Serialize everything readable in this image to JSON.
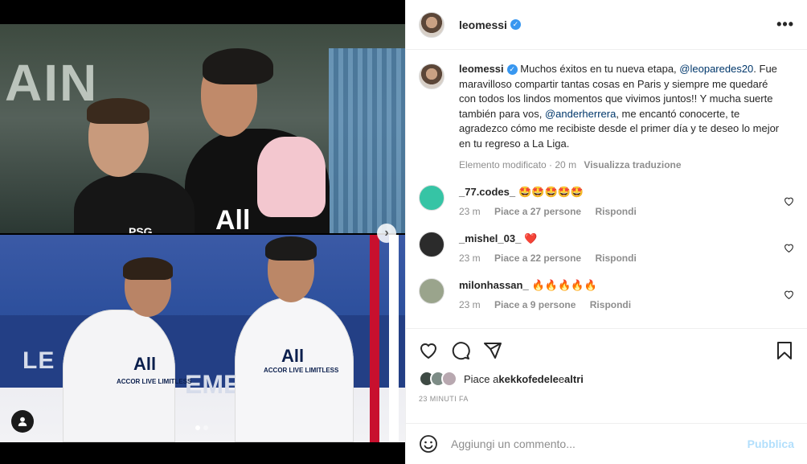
{
  "post": {
    "author": "leomessi",
    "verified": true,
    "more_icon": "more-options-icon"
  },
  "media": {
    "top_wall_text": "AIN",
    "top_jersey_logo": "All",
    "top_jersey_logo_small": "PSG",
    "bottom_wall_text": "LE",
    "bottom_wall_text2": "EMENT",
    "bottom_jersey_logo": "All",
    "bottom_jersey_sub": "ACCOR LIVE LIMITLESS",
    "carousel_dots": 2,
    "active_dot": 0
  },
  "caption": {
    "username": "leomessi",
    "parts": {
      "p1": " Muchos éxitos en tu nueva etapa, ",
      "m1": "@leoparedes20",
      "p2": ". Fue maravilloso compartir tantas cosas en Paris y siempre me quedaré con todos los lindos momentos que vivimos juntos!! Y mucha suerte también para vos, ",
      "m2": "@anderherrera",
      "p3": ", me encantó conocerte, te agradezco cómo me recibiste desde el primer día y te deseo lo mejor en tu regreso a La Liga."
    },
    "edited": "Elemento modificato · 20 m",
    "translate": "Visualizza traduzione"
  },
  "comments": [
    {
      "username": "_77.codes_",
      "text": "🤩🤩🤩🤩🤩",
      "time": "23 m",
      "likes": "Piace a 27 persone",
      "reply": "Rispondi",
      "avatar_color": "#36c4a5"
    },
    {
      "username": "_mishel_03_",
      "text": "❤️",
      "time": "23 m",
      "likes": "Piace a 22 persone",
      "reply": "Rispondi",
      "avatar_color": "#2b2b2b"
    },
    {
      "username": "milonhassan_",
      "text": "🔥🔥🔥🔥🔥",
      "time": "23 m",
      "likes": "Piace a 9 persone",
      "reply": "Rispondi",
      "avatar_color": "#9aa48c"
    }
  ],
  "likes": {
    "prefix": "Piace a ",
    "user": "kekkofedele",
    "mid": " e ",
    "others": "altri"
  },
  "timestamp": "23 MINUTI FA",
  "add_comment": {
    "placeholder": "Aggiungi un commento...",
    "publish": "Pubblica"
  },
  "colors": {
    "verified": "#3897f0",
    "mention": "#00376b",
    "publish_disabled": "#b2dffc",
    "muted": "#8e8e8e"
  }
}
